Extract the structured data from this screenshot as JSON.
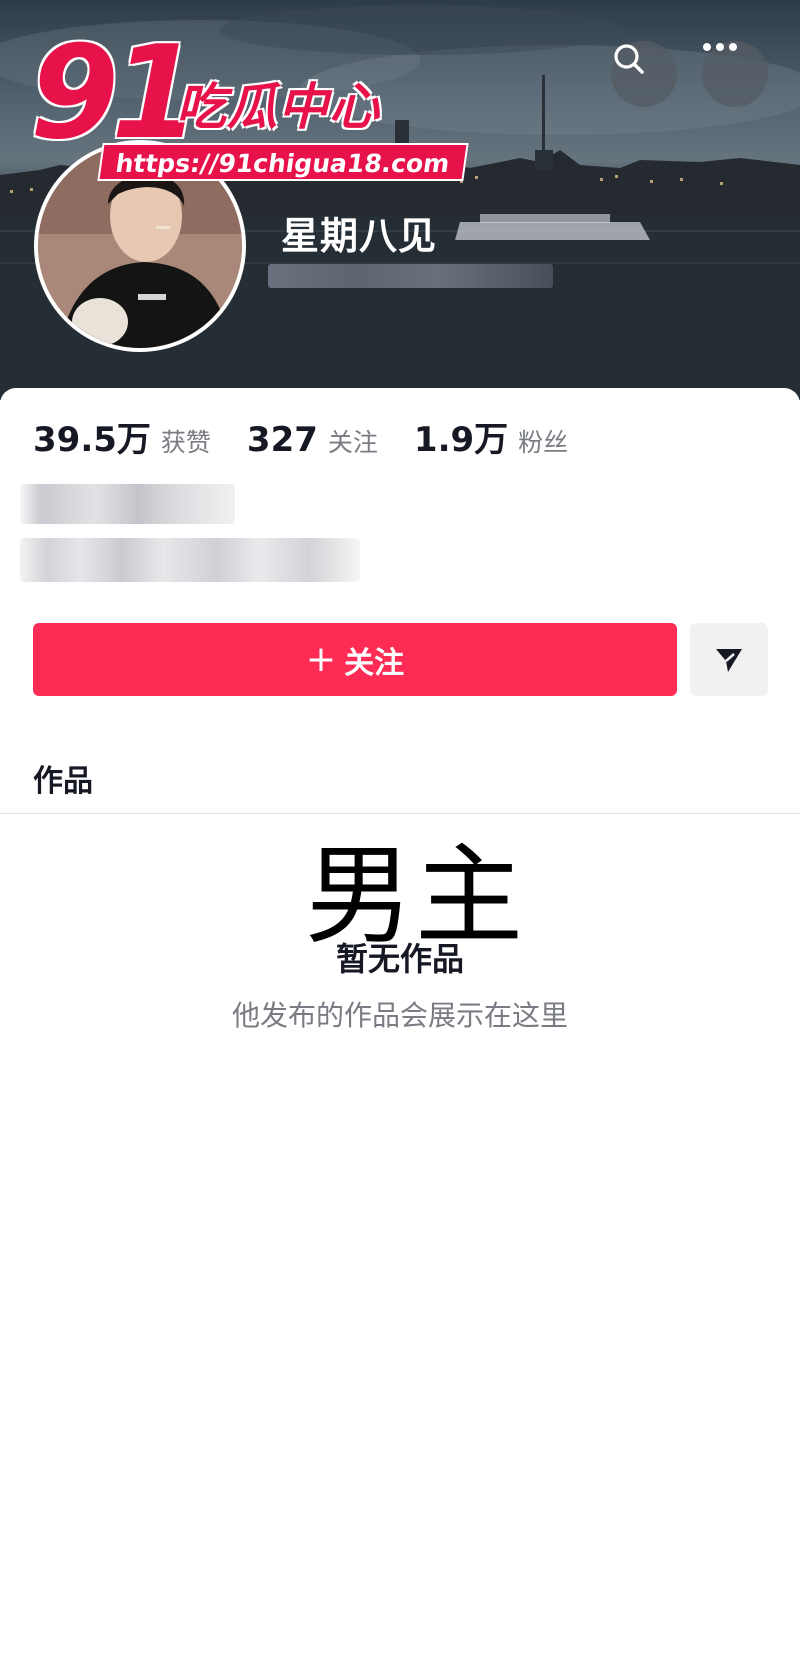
{
  "profile": {
    "username": "星期八见",
    "stats": [
      {
        "value": "39.5万",
        "label": "获赞"
      },
      {
        "value": "327",
        "label": "关注"
      },
      {
        "value": "1.9万",
        "label": "粉丝"
      }
    ]
  },
  "actions": {
    "follow_plus": "+",
    "follow_label": "关注"
  },
  "tabs": {
    "works": "作品"
  },
  "empty_state": {
    "title": "暂无作品",
    "subtitle": "他发布的作品会展示在这里"
  },
  "overlay": {
    "caption": "男主"
  },
  "watermark": {
    "number": "91",
    "chinese": "吃瓜中心",
    "url": "https://91chigua18.com"
  },
  "icons": {
    "search": "search-icon",
    "more": "more-icon",
    "send": "send-icon"
  },
  "colors": {
    "primary": "#fe2c55",
    "watermark": "#e8124a",
    "text": "#161823",
    "secondary_text": "#7a7c84"
  }
}
